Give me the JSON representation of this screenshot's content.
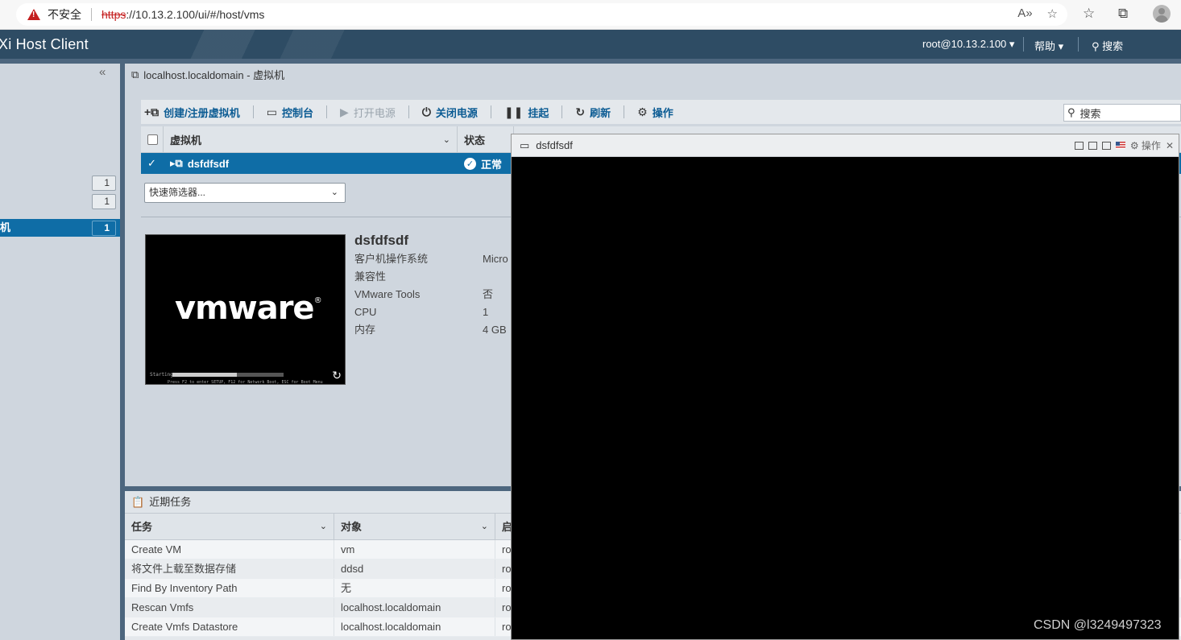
{
  "browser": {
    "security_label": "不安全",
    "url_scheme": "https",
    "url_rest": "://10.13.2.100/ui/#/host/vms"
  },
  "header": {
    "title": "Xi Host Client",
    "user": "root@10.13.2.100 ▾",
    "help": "帮助 ▾",
    "search": "搜索"
  },
  "navigator": {
    "collapse": "«",
    "selected_label": "机",
    "badges": [
      "1",
      "1",
      "1"
    ]
  },
  "main": {
    "breadcrumb": "localhost.localdomain - 虚拟机",
    "toolbar": {
      "create": "创建/注册虚拟机",
      "console": "控制台",
      "power_on": "打开电源",
      "power_off": "关闭电源",
      "suspend": "挂起",
      "refresh": "刷新",
      "actions": "操作",
      "search_placeholder": "搜索"
    },
    "grid": {
      "col_vm": "虚拟机",
      "col_status": "状态",
      "row": {
        "name": "dsfdfsdf",
        "status": "正常"
      }
    },
    "filter_placeholder": "快速筛选器...",
    "detail": {
      "name": "dsfdfsdf",
      "props": [
        {
          "label": "客户机操作系统",
          "value": "Micro"
        },
        {
          "label": "兼容性",
          "value": ""
        },
        {
          "label": "VMware Tools",
          "value": "否"
        },
        {
          "label": "CPU",
          "value": "1"
        },
        {
          "label": "内存",
          "value": "4 GB"
        }
      ],
      "thumb": {
        "logo": "vmware",
        "starting": "Starting",
        "press": "Press F2 to enter SETUP, F12 for Network Boot, ESC for Boot Menu"
      }
    }
  },
  "tasks": {
    "title": "近期任务",
    "cols": [
      "任务",
      "对象",
      "启"
    ],
    "rows": [
      {
        "task": "Create VM",
        "object": "vm",
        "init": "ro"
      },
      {
        "task": "将文件上载至数据存储",
        "object": "ddsd",
        "init": "ro"
      },
      {
        "task": "Find By Inventory Path",
        "object": "无",
        "init": "ro"
      },
      {
        "task": "Rescan Vmfs",
        "object": "localhost.localdomain",
        "init": "ro"
      },
      {
        "task": "Create Vmfs Datastore",
        "object": "localhost.localdomain",
        "init": "ro"
      }
    ]
  },
  "console": {
    "title": "dsfdfsdf",
    "actions": "操作",
    "close": "✕"
  },
  "watermark": "CSDN @l3249497323"
}
